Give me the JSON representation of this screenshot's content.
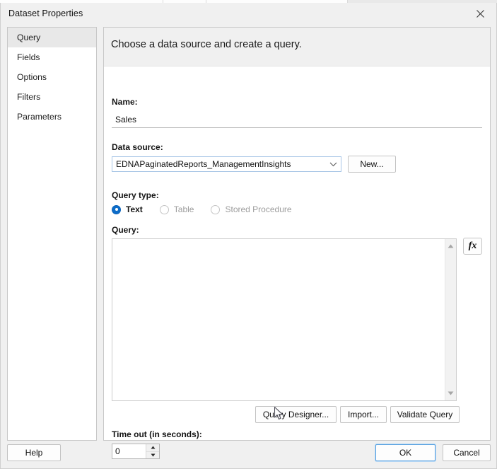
{
  "window": {
    "title": "Dataset Properties",
    "close_icon": "close-icon"
  },
  "sidebar": {
    "items": [
      {
        "label": "Query"
      },
      {
        "label": "Fields"
      },
      {
        "label": "Options"
      },
      {
        "label": "Filters"
      },
      {
        "label": "Parameters"
      }
    ],
    "selected_index": 0
  },
  "panel": {
    "heading": "Choose a data source and create a query.",
    "name": {
      "label": "Name:",
      "value": "Sales",
      "placeholder": ""
    },
    "data_source": {
      "label": "Data source:",
      "value": "EDNAPaginatedReports_ManagementInsights",
      "arrow_icon": "chevron-down-icon",
      "new_button": "New..."
    },
    "query_type": {
      "label": "Query type:",
      "options": [
        {
          "label": "Text",
          "selected": true,
          "disabled": false
        },
        {
          "label": "Table",
          "selected": false,
          "disabled": true
        },
        {
          "label": "Stored Procedure",
          "selected": false,
          "disabled": true
        }
      ]
    },
    "query": {
      "label": "Query:",
      "value": "",
      "placeholder": "",
      "expression_button": "fx",
      "scroll_up_icon": "triangle-up-icon",
      "scroll_down_icon": "triangle-down-icon"
    },
    "actions": {
      "query_designer": "Query Designer...",
      "import": "Import...",
      "validate_query": "Validate Query"
    },
    "timeout": {
      "label": "Time out (in seconds):",
      "value": "0",
      "up_icon": "spinner-up-icon",
      "down_icon": "spinner-down-icon"
    }
  },
  "footer": {
    "help": "Help",
    "ok": "OK",
    "cancel": "Cancel"
  },
  "colors": {
    "accent": "#0d6cc8",
    "focus_border": "#5ba3e0",
    "dialog_bg": "#f0f0f0",
    "panel_bg": "#ffffff"
  }
}
